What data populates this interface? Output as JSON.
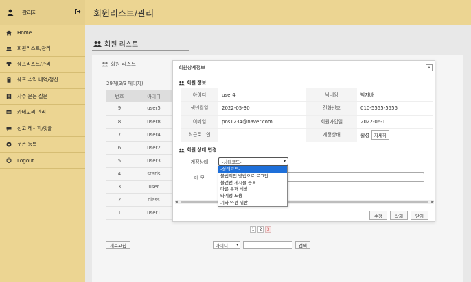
{
  "sidebar": {
    "admin_label": "관리자",
    "items": [
      {
        "label": "Home",
        "icon": "home-icon"
      },
      {
        "label": "회원리스트/관리",
        "icon": "users-icon"
      },
      {
        "label": "쉐프리스트/관리",
        "icon": "chef-icon"
      },
      {
        "label": "쉐프 수익 내역/정산",
        "icon": "money-icon"
      },
      {
        "label": "자주 묻는 질문",
        "icon": "faq-icon"
      },
      {
        "label": "카테고리 관리",
        "icon": "category-icon"
      },
      {
        "label": "신고 레시피/댓글",
        "icon": "report-icon"
      },
      {
        "label": "쿠폰 등록",
        "icon": "coupon-icon"
      },
      {
        "label": "Logout",
        "icon": "power-icon"
      }
    ]
  },
  "header": {
    "title": "회원리스트/관리"
  },
  "main": {
    "title": "회원 리스트",
    "subtitle": "회원 리스트",
    "count": "29개(3/3 페이지)",
    "columns": [
      "번호",
      "아이디"
    ],
    "rows": [
      [
        "9",
        "user5"
      ],
      [
        "8",
        "user8"
      ],
      [
        "7",
        "user4"
      ],
      [
        "6",
        "user2"
      ],
      [
        "5",
        "user3"
      ],
      [
        "4",
        "staris"
      ],
      [
        "3",
        "user"
      ],
      [
        "2",
        "class"
      ],
      [
        "1",
        "user1"
      ]
    ],
    "pages": [
      "1",
      "2",
      "3"
    ],
    "refresh_label": "새로고침",
    "search_option": "아이디",
    "search_button": "검색"
  },
  "modal": {
    "title": "회원상세정보",
    "close": "×",
    "info_section": "회원 정보",
    "info": {
      "id_label": "아이디",
      "id": "user4",
      "nick_label": "닉네임",
      "nick": "박자바",
      "birth_label": "생년월일",
      "birth": "2022-05-30",
      "phone_label": "전화번호",
      "phone": "010-5555-5555",
      "email_label": "이메일",
      "email": "pos1234@naver.com",
      "joined_label": "회원가입일",
      "joined": "2022-06-11",
      "lastlogin_label": "최근로그인",
      "lastlogin": "",
      "status_label": "계정상태",
      "status": "활성",
      "detail_btn": "자세히"
    },
    "change_section": "회원 상태 변경",
    "status_field_label": "계정상태",
    "status_select": "-상태코드-",
    "memo_label": "메 모",
    "buttons": {
      "edit": "수정",
      "delete": "삭제",
      "close": "닫기"
    }
  },
  "dropdown": {
    "options": [
      "-상태코드-",
      "불법적인 방법으로 로그인",
      "불건전 게시물 등록",
      "다른 유저 비방",
      "타계정 도용",
      "기타 약관 위반"
    ],
    "selected_index": 0
  },
  "colors": {
    "sidebar": "#ecd592",
    "select_highlight": "#1e6fd9"
  }
}
